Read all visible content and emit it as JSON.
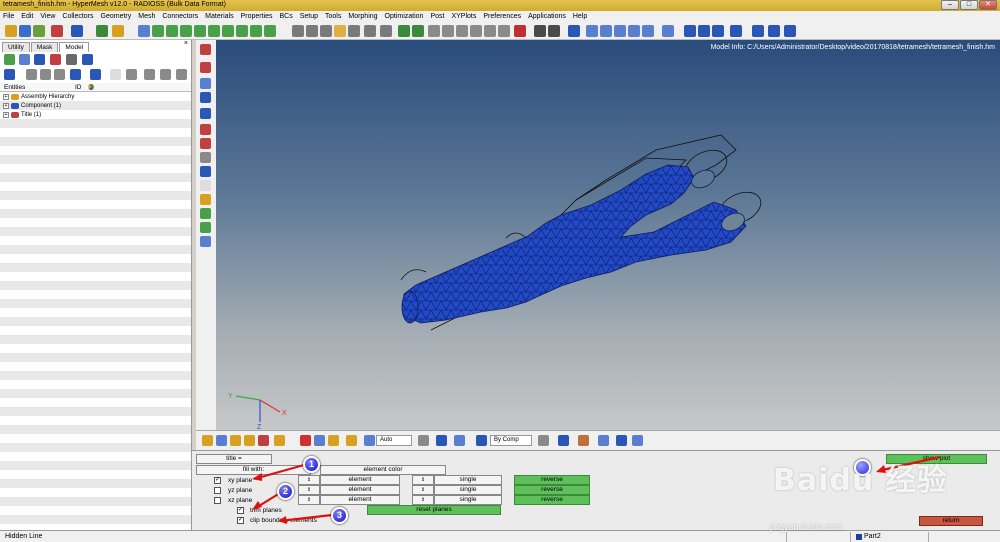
{
  "window": {
    "title": "tetramesh_finish.hm - HyperMesh v12.0 - RADIOSS (Bulk Data Format)",
    "minimize": "–",
    "maximize": "□",
    "close": "✕"
  },
  "menu": [
    "File",
    "Edit",
    "View",
    "Collectors",
    "Geometry",
    "Mesh",
    "Connectors",
    "Materials",
    "Properties",
    "BCs",
    "Setup",
    "Tools",
    "Morphing",
    "Optimization",
    "Post",
    "XYPlots",
    "Preferences",
    "Applications",
    "Help"
  ],
  "left_panel": {
    "tabs": [
      "Utility",
      "Mask",
      "Model"
    ],
    "close": "×",
    "columns": {
      "entities": "Entities",
      "id": "ID"
    },
    "tree": [
      {
        "expander": "+",
        "label": "Assembly Hierarchy"
      },
      {
        "expander": "+",
        "label": "Component (1)"
      },
      {
        "expander": "+",
        "label": "Title (1)"
      }
    ]
  },
  "viewport": {
    "model_info": "Model Info: C:/Users/Administrator/Desktop/video/20170818/tetramesh/tetramesh_finish.hm",
    "axis_labels": {
      "x": "X",
      "y": "Y",
      "z": "Z"
    }
  },
  "bottom_toolbar": {
    "auto": "Auto",
    "by_comp": "By Comp"
  },
  "panel": {
    "title_button": "title =",
    "show_plot": "show plot",
    "fill_with": "fill with:",
    "element_color": "element color",
    "rows": [
      {
        "checked": true,
        "label": "xy plane",
        "spin": "⇕",
        "field1": "element",
        "spin2": "⇕",
        "field2": "single",
        "action": "reverse"
      },
      {
        "checked": false,
        "label": "yz plane",
        "spin": "⇕",
        "field1": "element",
        "spin2": "⇕",
        "field2": "single",
        "action": "reverse"
      },
      {
        "checked": false,
        "label": "xz plane",
        "spin": "⇕",
        "field1": "element",
        "spin2": "⇕",
        "field2": "single",
        "action": "reverse"
      }
    ],
    "trim_planes": {
      "checked": true,
      "label": "trim planes"
    },
    "reset_planes": "reset planes",
    "clip_boundary": {
      "checked": true,
      "label": "clip boundary elements"
    },
    "return": "return",
    "markers": [
      "1",
      "2",
      "3"
    ]
  },
  "status": {
    "left": "Hidden Line",
    "part": "Part2"
  },
  "watermark": {
    "brand": "Baidu 经验",
    "url": "jingyan.baidu.com"
  },
  "colors": {
    "mesh_blue": "#2149c8",
    "green_button": "#5ec05b",
    "return_button": "#c9563f",
    "title_bar": "#d9b338"
  }
}
